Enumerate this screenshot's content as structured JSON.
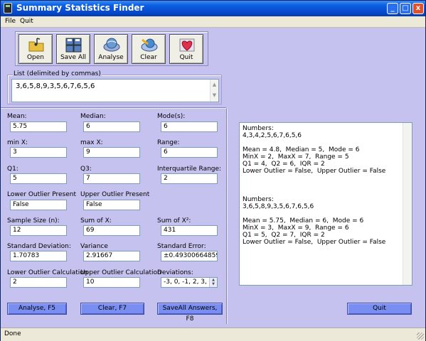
{
  "window": {
    "title": "Summary Statistics Finder",
    "min_glyph": "_",
    "max_glyph": "□",
    "close_glyph": "x"
  },
  "menu": {
    "file": "File",
    "quit": "Quit"
  },
  "toolbar": {
    "open": "Open",
    "save_all": "Save All",
    "analyse": "Analyse",
    "clear": "Clear",
    "quit": "Quit"
  },
  "list": {
    "legend": "List (delimited by commas)",
    "value": "3,6,5,8,9,3,5,6,7,6,5,6"
  },
  "fields": {
    "mean": {
      "label": "Mean:",
      "value": "5.75"
    },
    "median": {
      "label": "Median:",
      "value": "6"
    },
    "mode": {
      "label": "Mode(s):",
      "value": "6"
    },
    "min_x": {
      "label": "min X:",
      "value": "3"
    },
    "max_x": {
      "label": "max X:",
      "value": "9"
    },
    "range": {
      "label": "Range:",
      "value": "6"
    },
    "q1": {
      "label": "Q1:",
      "value": "5"
    },
    "q3": {
      "label": "Q3:",
      "value": "7"
    },
    "iqr": {
      "label": "Interquartile Range:",
      "value": "2"
    },
    "lower_outlier_present": {
      "label": "Lower Outlier Present",
      "value": "False"
    },
    "upper_outlier_present": {
      "label": "Upper Outlier Present",
      "value": "False"
    },
    "sample_size": {
      "label": "Sample Size (n):",
      "value": "12"
    },
    "sum_x": {
      "label": "Sum of X:",
      "value": "69"
    },
    "sum_x2": {
      "label": "Sum of X²:",
      "value": "431"
    },
    "std_dev": {
      "label": "Standard Deviation:",
      "value": "1.70783"
    },
    "variance": {
      "label": "Variance",
      "value": "2.91667"
    },
    "std_error": {
      "label": "Standard Error:",
      "value": "±0.4930066485916"
    },
    "lower_outlier_calc": {
      "label": "Lower Outlier Calculation",
      "value": "2"
    },
    "upper_outlier_calc": {
      "label": "Upper Outlier Calculation",
      "value": "10"
    },
    "deviations": {
      "label": "Deviations:",
      "value": "-3, 0, -1, 2, 3,"
    }
  },
  "buttons": {
    "analyse": "Analyse, F5",
    "clear": "Clear, F7",
    "save_all_answers": "SaveAll Answers, F8",
    "quit": "Quit"
  },
  "output_lines": [
    "Numbers:",
    "4,3,4,2,5,6,7,6,5,6",
    "",
    "Mean = 4.8,  Median = 5,  Mode = 6",
    "MinX = 2,  MaxX = 7,  Range = 5",
    "Q1 = 4,  Q2 = 6,  IQR = 2",
    "Lower Outlier = False,  Upper Outlier = False",
    "",
    "",
    "",
    "Numbers:",
    "3,6,5,8,9,3,5,6,7,6,5,6",
    "",
    "Mean = 5.75,  Median = 6,  Mode = 6",
    "MinX = 3,  MaxX = 9,  Range = 6",
    "Q1 = 5,  Q2 = 7,  IQR = 2",
    "Lower Outlier = False,  Upper Outlier = False"
  ],
  "status": "Done",
  "icons": {
    "open": "folder-music-icon",
    "save_all": "disk-stack-icon",
    "analyse": "globe-icon",
    "clear": "eraser-globe-icon",
    "quit": "heart-icon"
  }
}
